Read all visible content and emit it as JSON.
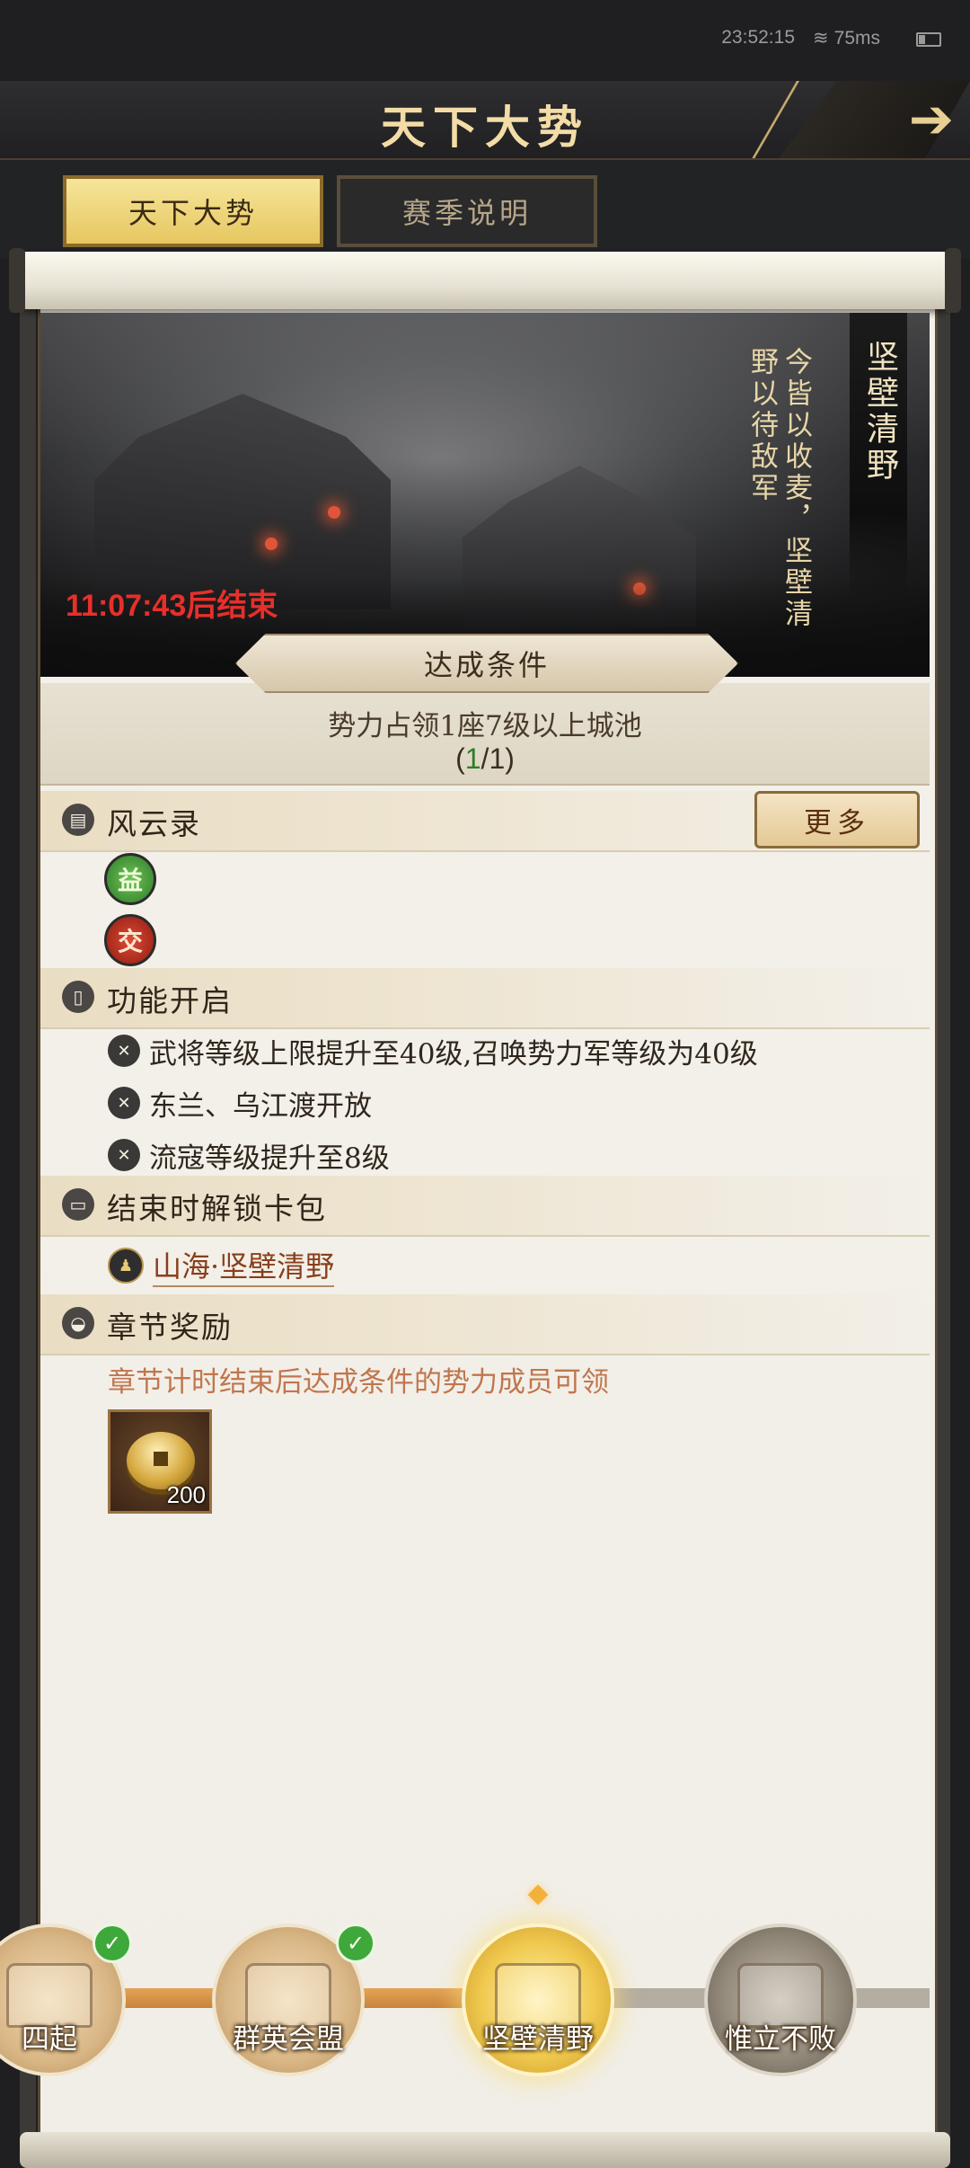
{
  "status": {
    "time": "23:52:15",
    "ping": "75ms"
  },
  "header": {
    "title": "天下大势",
    "back_icon": "arrow-right-icon"
  },
  "tabs": [
    {
      "label": "天下大势",
      "active": true
    },
    {
      "label": "赛季说明",
      "active": false
    }
  ],
  "banner": {
    "tag": "坚壁清野",
    "poem_line1": "今皆以收麦，坚壁清",
    "poem_line2": "野以待敌军",
    "timer": "11:07:43后结束"
  },
  "condition": {
    "title": "达成条件",
    "text": "势力占领1座7级以上城池",
    "progress_open": "(",
    "progress_done": "1",
    "progress_rest": "/1)"
  },
  "fengyun": {
    "title": "风云录",
    "more_label": "更多",
    "badges": [
      {
        "glyph": "益",
        "color": "#3f9a32"
      },
      {
        "glyph": "交",
        "color": "#c7301f"
      }
    ]
  },
  "features": {
    "title": "功能开启",
    "items": [
      "武将等级上限提升至40级,召唤势力军等级为40级",
      "东兰、乌江渡开放",
      "流寇等级提升至8级"
    ]
  },
  "card_pack": {
    "title": "结束时解锁卡包",
    "item": "山海·坚壁清野"
  },
  "chapter_reward": {
    "title": "章节奖励",
    "note": "章节计时结束后达成条件的势力成员可领",
    "item_qty": "200"
  },
  "progress_track": {
    "chests": [
      {
        "label": "四起",
        "state": "done"
      },
      {
        "label": "群英会盟",
        "state": "done"
      },
      {
        "label": "坚壁清野",
        "state": "current"
      },
      {
        "label": "惟立不败",
        "state": "locked"
      }
    ]
  },
  "colors": {
    "accent_gold": "#f3dca6",
    "timer_red": "#e82f2a",
    "progress_green": "#2f7e2b"
  }
}
